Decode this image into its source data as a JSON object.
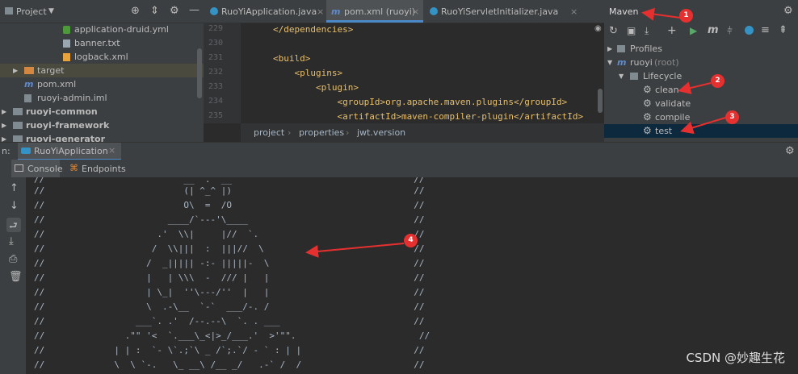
{
  "project": {
    "title": "Project",
    "items": [
      {
        "label": "application-druid.yml",
        "icon": "yml-file-icon"
      },
      {
        "label": "banner.txt",
        "icon": "text-file-icon"
      },
      {
        "label": "logback.xml",
        "icon": "xml-file-icon"
      },
      {
        "label": "target",
        "icon": "folder-icon"
      },
      {
        "label": "pom.xml",
        "icon": "maven-file-icon"
      },
      {
        "label": "ruoyi-admin.iml",
        "icon": "iml-file-icon"
      },
      {
        "label": "ruoyi-common",
        "icon": "module-folder-icon"
      },
      {
        "label": "ruoyi-framework",
        "icon": "module-folder-icon"
      },
      {
        "label": "ruoyi-generator",
        "icon": "module-folder-icon"
      }
    ]
  },
  "editor": {
    "tabs": [
      {
        "label": "RuoYiApplication.java"
      },
      {
        "label": "pom.xml (ruoyi)"
      },
      {
        "label": "RuoYiServletInitializer.java"
      }
    ],
    "line_numbers": [
      "229",
      "230",
      "231",
      "232",
      "233",
      "234",
      "235"
    ],
    "code_lines": [
      "</dependencies>",
      "",
      "<build>",
      "    <plugins>",
      "        <plugin>",
      "            <groupId>org.apache.maven.plugins</groupId>",
      "            <artifactId>maven-compiler-plugin</artifactId>"
    ],
    "breadcrumb": [
      "project",
      "properties",
      "jwt.version"
    ]
  },
  "maven": {
    "title": "Maven",
    "tree": [
      {
        "label": "Profiles"
      },
      {
        "label": "ruoyi",
        "suffix": "(root)"
      },
      {
        "label": "Lifecycle"
      },
      {
        "label": "clean"
      },
      {
        "label": "validate"
      },
      {
        "label": "compile"
      },
      {
        "label": "test"
      }
    ]
  },
  "run": {
    "label": "n:",
    "config": "RuoYiApplication",
    "subtabs": [
      "Console",
      "Endpoints"
    ]
  },
  "console_lines": [
    "//                          (| ^_^ |)                                  //",
    "//                          O\\  =  /O                                  //",
    "//                       ____/`---'\\____                               //",
    "//                     .'  \\\\|     |//  `.                             //",
    "//                    /  \\\\|||  :  |||//  \\                            //",
    "//                   /  _||||| -:- |||||-  \\                           //",
    "//                   |   | \\\\\\  -  /// |   |                           //",
    "//                   | \\_|  ''\\---/''  |   |                           //",
    "//                   \\  .-\\__  `-`  ___/-. /                           //",
    "//                 ___`. .'  /--.--\\  `. . ___                         //",
    "//               .\"\" '<  `.___\\_<|>_/___.'  >'\"\".                       //",
    "//             | | :  `- \\`.;`\\ _ /`;.`/ - ` : | |                     //",
    "//             \\  \\ `-.   \\_ __\\ /__ _/   .-` /  /                     //"
  ],
  "annotations": [
    "1",
    "2",
    "3",
    "4"
  ],
  "watermark": "CSDN @妙趣生花",
  "colors": {
    "annotation": "#e63030",
    "accent": "#4a88c7"
  }
}
